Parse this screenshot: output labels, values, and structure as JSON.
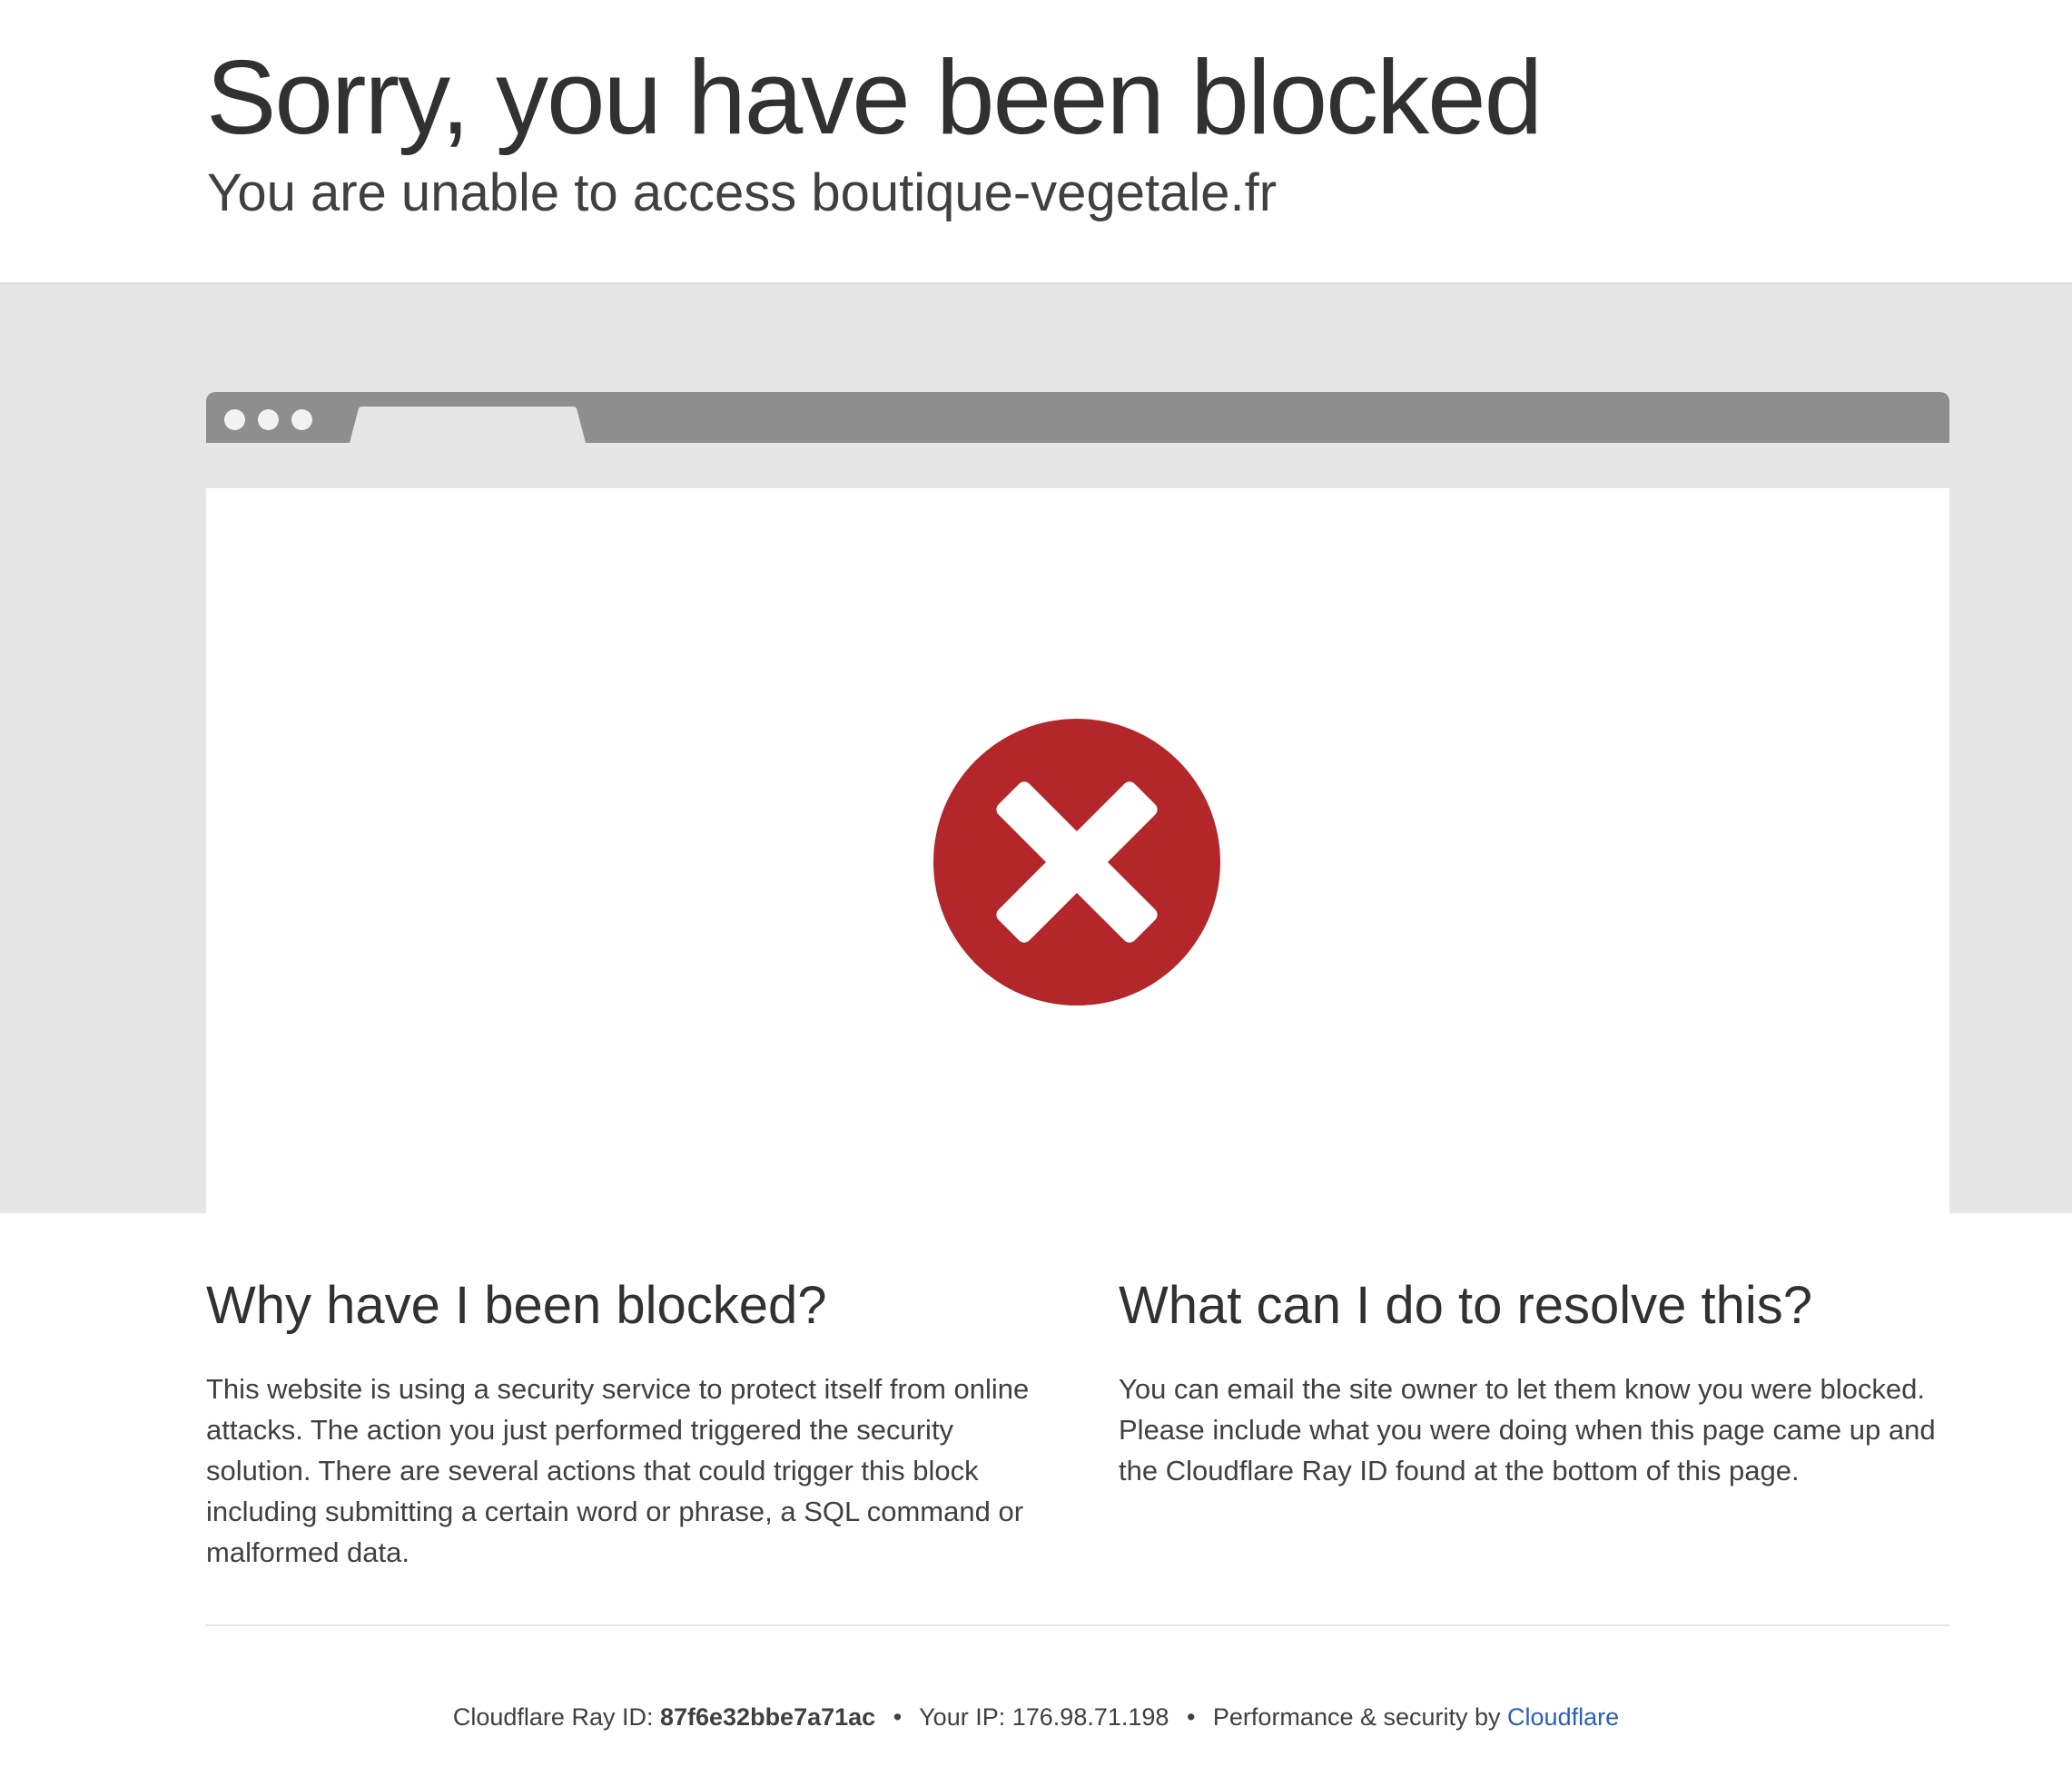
{
  "header": {
    "title": "Sorry, you have been blocked",
    "subtitle": "You are unable to access boutique-vegetale.fr"
  },
  "illustration": {
    "icon": "error-x-icon",
    "icon_color": "#b3262a"
  },
  "why": {
    "heading": "Why have I been blocked?",
    "text": "This website is using a security service to protect itself from online attacks. The action you just performed triggered the security solution. There are several actions that could trigger this block including submitting a certain word or phrase, a SQL command or malformed data."
  },
  "resolve": {
    "heading": "What can I do to resolve this?",
    "text": "You can email the site owner to let them know you were blocked. Please include what you were doing when this page came up and the Cloudflare Ray ID found at the bottom of this page."
  },
  "footer": {
    "ray_label": "Cloudflare Ray ID:",
    "ray_id": "87f6e32bbe7a71ac",
    "separator": "•",
    "ip_label": "Your IP:",
    "ip": "176.98.71.198",
    "perf_label": "Performance & security by",
    "link_label": "Cloudflare",
    "link_color": "#2c5fb7"
  }
}
